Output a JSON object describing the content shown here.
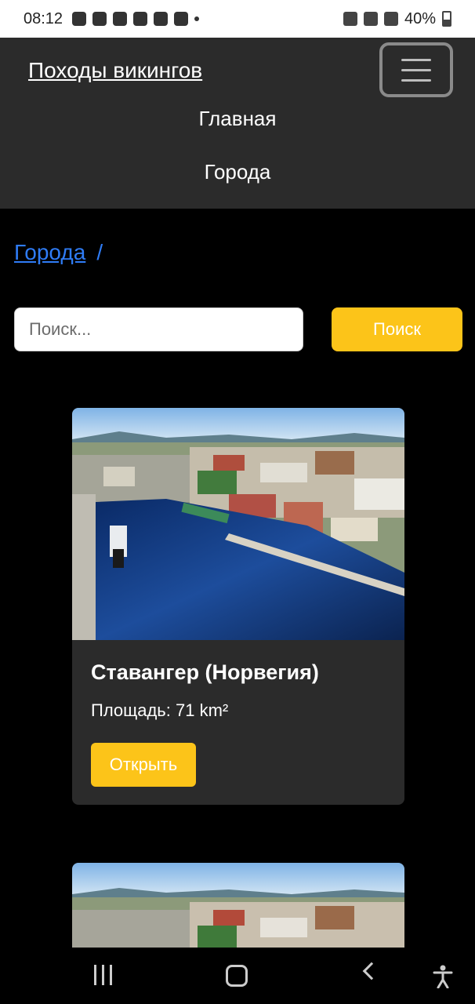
{
  "status_bar": {
    "time": "08:12",
    "battery": "40%"
  },
  "navbar": {
    "brand": "Походы викингов",
    "links": [
      "Главная",
      "Города"
    ]
  },
  "breadcrumb": {
    "items": [
      "Города"
    ],
    "separator": "/"
  },
  "search": {
    "placeholder": "Поиск...",
    "button_label": "Поиск"
  },
  "cards": [
    {
      "title": "Ставангер (Норвегия)",
      "area_text": "Площадь: 71 km²",
      "button_label": "Открыть"
    }
  ],
  "colors": {
    "accent": "#fcc419",
    "navbar_bg": "#2b2b2b",
    "link": "#2f7cf6",
    "page_bg": "#000000"
  }
}
